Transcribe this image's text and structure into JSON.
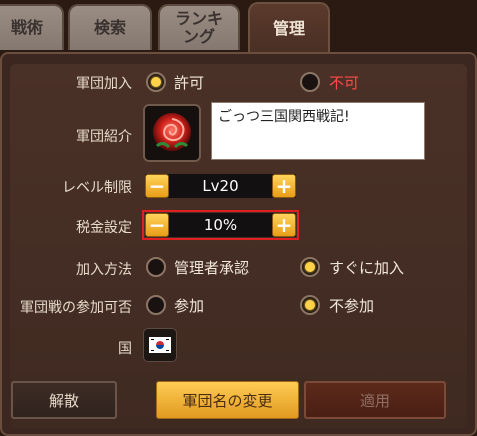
{
  "tabs": [
    {
      "label": "戦術",
      "active": false
    },
    {
      "label": "検索",
      "active": false
    },
    {
      "label": "ランキ\nング",
      "active": false
    },
    {
      "label": "管理",
      "active": true
    }
  ],
  "join": {
    "label": "軍団加入",
    "options": [
      {
        "label": "許可",
        "selected": true
      },
      {
        "label": "不可",
        "selected": false,
        "color": "#ff4a4a"
      }
    ]
  },
  "intro": {
    "label": "軍団紹介",
    "emblem_icon": "rose-emblem-icon",
    "text": "ごっつ三国関西戦記!"
  },
  "level": {
    "label": "レベル制限",
    "value": "Lv20"
  },
  "tax": {
    "label": "税金設定",
    "value": "10%"
  },
  "join_method": {
    "label": "加入方法",
    "options": [
      {
        "label": "管理者承認",
        "selected": false
      },
      {
        "label": "すぐに加入",
        "selected": true
      }
    ]
  },
  "war": {
    "label": "軍団戦の参加可否",
    "options": [
      {
        "label": "参加",
        "selected": false
      },
      {
        "label": "不参加",
        "selected": true
      }
    ]
  },
  "country": {
    "label": "国",
    "flag_icon": "south-korea-flag-icon"
  },
  "buttons": {
    "disband": "解散",
    "rename": "軍団名の変更",
    "apply": "適用"
  },
  "colors": {
    "accent_gold": "#ffd24a",
    "highlight_red": "#e02020",
    "panel_brown": "#3b271f"
  }
}
